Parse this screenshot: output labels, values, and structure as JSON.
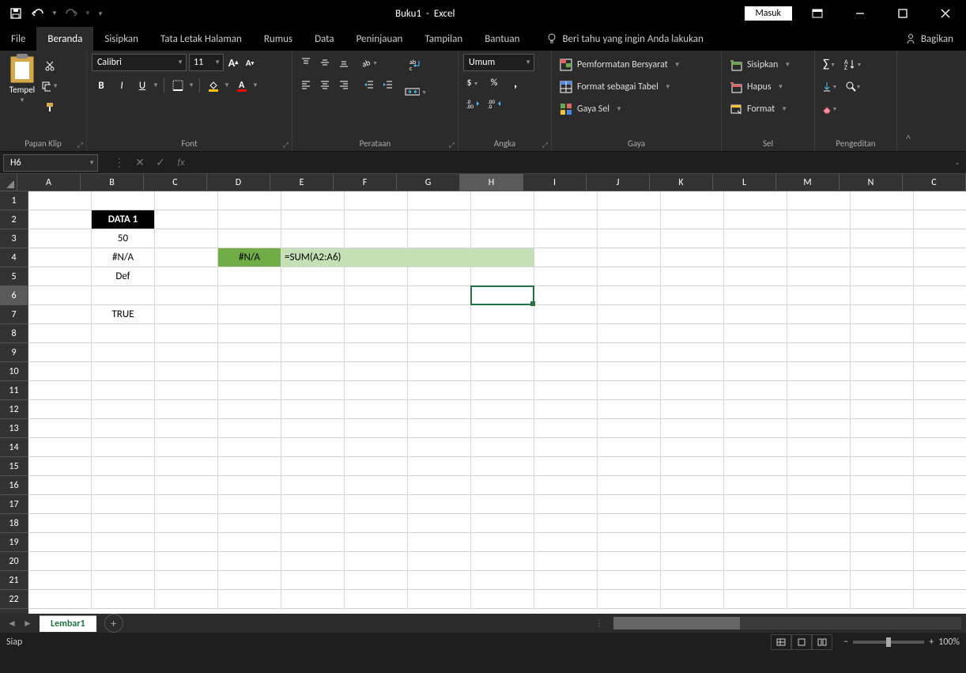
{
  "titlebar": {
    "doc": "Buku1",
    "app": "Excel",
    "login": "Masuk"
  },
  "tabs": {
    "file": "File",
    "home": "Beranda",
    "insert": "Sisipkan",
    "layout": "Tata Letak Halaman",
    "formulas": "Rumus",
    "data": "Data",
    "review": "Peninjauan",
    "view": "Tampilan",
    "help": "Bantuan",
    "tellme": "Beri tahu yang ingin Anda lakukan",
    "share": "Bagikan"
  },
  "ribbon": {
    "clipboard": {
      "paste": "Tempel",
      "label": "Papan Klip"
    },
    "font": {
      "name": "Calibri",
      "size": "11",
      "bold": "B",
      "italic": "I",
      "underline": "U",
      "label": "Font"
    },
    "alignment": {
      "label": "Perataan"
    },
    "number": {
      "format": "Umum",
      "label": "Angka"
    },
    "styles": {
      "cond": "Pemformatan Bersyarat",
      "table": "Format sebagai Tabel",
      "cellstyle": "Gaya Sel",
      "label": "Gaya"
    },
    "cells": {
      "insert": "Sisipkan",
      "delete": "Hapus",
      "format": "Format",
      "label": "Sel"
    },
    "editing": {
      "label": "Pengeditan"
    }
  },
  "formulabar": {
    "namebox": "H6",
    "formula": ""
  },
  "grid": {
    "columns": [
      "A",
      "B",
      "C",
      "D",
      "E",
      "F",
      "G",
      "H",
      "I",
      "J",
      "K",
      "L",
      "M",
      "N",
      "C"
    ],
    "rows": [
      "1",
      "2",
      "3",
      "4",
      "5",
      "6",
      "7",
      "8",
      "9",
      "10",
      "11",
      "12",
      "13",
      "14",
      "15",
      "16",
      "17",
      "18",
      "19",
      "20",
      "21",
      "22"
    ],
    "selected_col": "H",
    "selected_row": "6",
    "cells": {
      "B2": "DATA 1",
      "B3": "50",
      "B4": "#N/A",
      "B5": "Def",
      "B7": "TRUE",
      "D4": "#N/A",
      "E4": "=SUM(A2:A6)"
    }
  },
  "sheet": {
    "name": "Lembar1"
  },
  "status": {
    "ready": "Siap",
    "zoom": "100%"
  }
}
